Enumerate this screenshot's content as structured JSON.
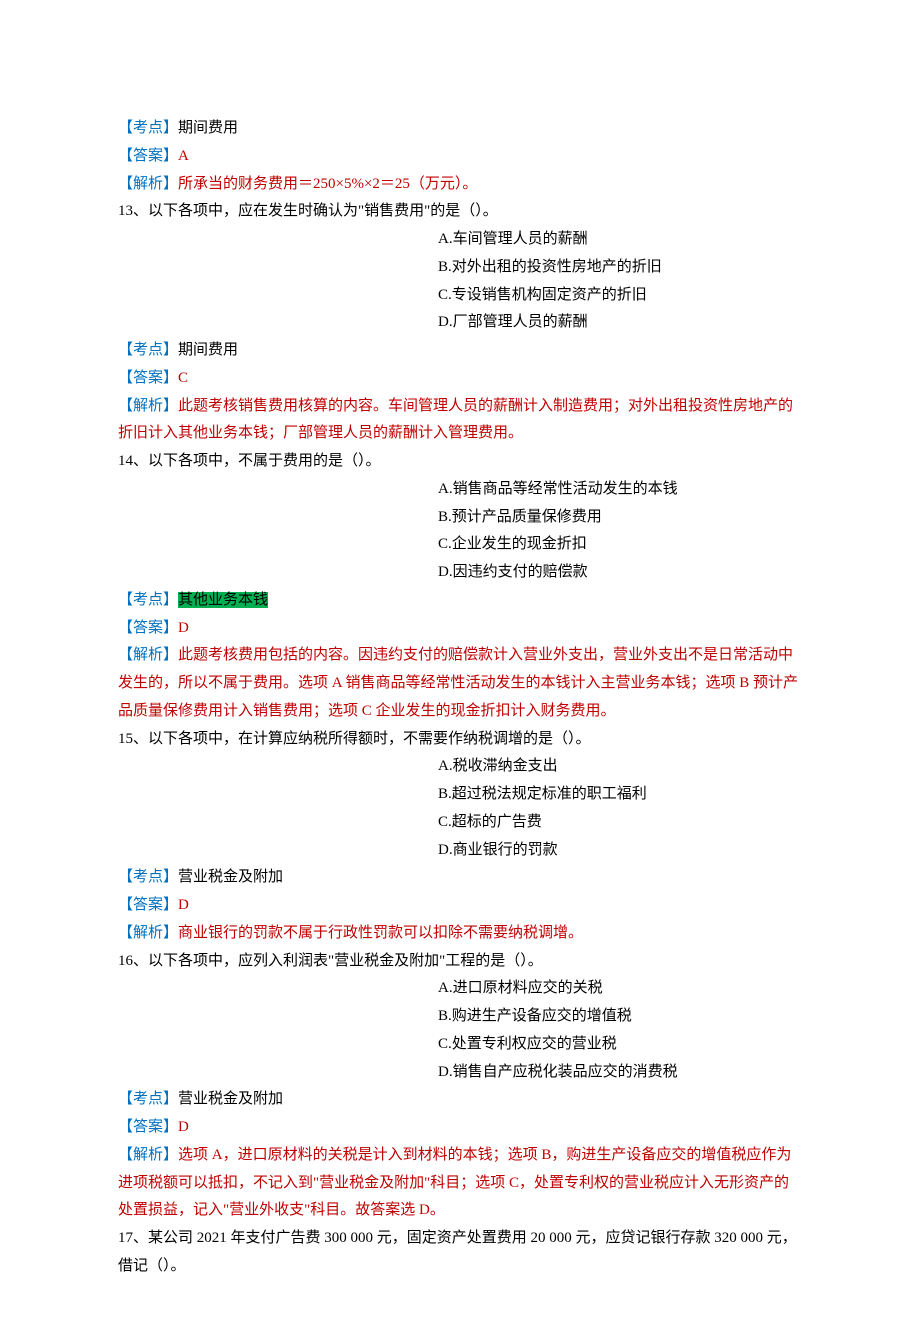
{
  "labels": {
    "kd": "【考点】",
    "da": "【答案】",
    "jx": "【解析】"
  },
  "q12_tail": {
    "topic": "期间费用",
    "ans": "A",
    "jx": "所承当的财务费用＝250×5%×2＝25（万元）。"
  },
  "q13": {
    "stem": "13、以下各项中，应在发生时确认为\"销售费用\"的是（）。",
    "opts": [
      "A.车间管理人员的薪酬",
      "B.对外出租的投资性房地产的折旧",
      "C.专设销售机构固定资产的折旧",
      "D.厂部管理人员的薪酬"
    ],
    "topic": "期间费用",
    "ans": "C",
    "jx": "此题考核销售费用核算的内容。车间管理人员的薪酬计入制造费用；对外出租投资性房地产的折旧计入其他业务本钱；厂部管理人员的薪酬计入管理费用。"
  },
  "q14": {
    "stem": "14、以下各项中，不属于费用的是（）。",
    "opts": [
      "A.销售商品等经常性活动发生的本钱",
      "B.预计产品质量保修费用",
      "C.企业发生的现金折扣",
      "D.因违约支付的赔偿款"
    ],
    "topic": "其他业务本钱",
    "ans": "D",
    "jx": "此题考核费用包括的内容。因违约支付的赔偿款计入营业外支出，营业外支出不是日常活动中发生的，所以不属于费用。选项 A 销售商品等经常性活动发生的本钱计入主营业务本钱；选项 B 预计产品质量保修费用计入销售费用；选项 C 企业发生的现金折扣计入财务费用。"
  },
  "q15": {
    "stem": "15、以下各项中，在计算应纳税所得额时，不需要作纳税调增的是（）。",
    "opts": [
      "A.税收滞纳金支出",
      "B.超过税法规定标准的职工福利",
      "C.超标的广告费",
      "D.商业银行的罚款"
    ],
    "topic": "营业税金及附加",
    "ans": "D",
    "jx": "商业银行的罚款不属于行政性罚款可以扣除不需要纳税调增。"
  },
  "q16": {
    "stem": "16、以下各项中，应列入利润表\"营业税金及附加\"工程的是（）。",
    "opts": [
      "A.进口原材料应交的关税",
      "B.购进生产设备应交的增值税",
      "C.处置专利权应交的营业税",
      "D.销售自产应税化装品应交的消费税"
    ],
    "topic": "营业税金及附加",
    "ans": "D",
    "jx": "选项 A，进口原材料的关税是计入到材料的本钱；选项 B，购进生产设备应交的增值税应作为进项税额可以抵扣，不记入到\"营业税金及附加\"科目；选项 C，处置专利权的营业税应计入无形资产的处置损益，记入\"营业外收支\"科目。故答案选 D。"
  },
  "q17": {
    "stem": "17、某公司 2021 年支付广告费 300 000 元，固定资产处置费用 20 000 元，应贷记银行存款 320 000 元，借记（）。"
  }
}
